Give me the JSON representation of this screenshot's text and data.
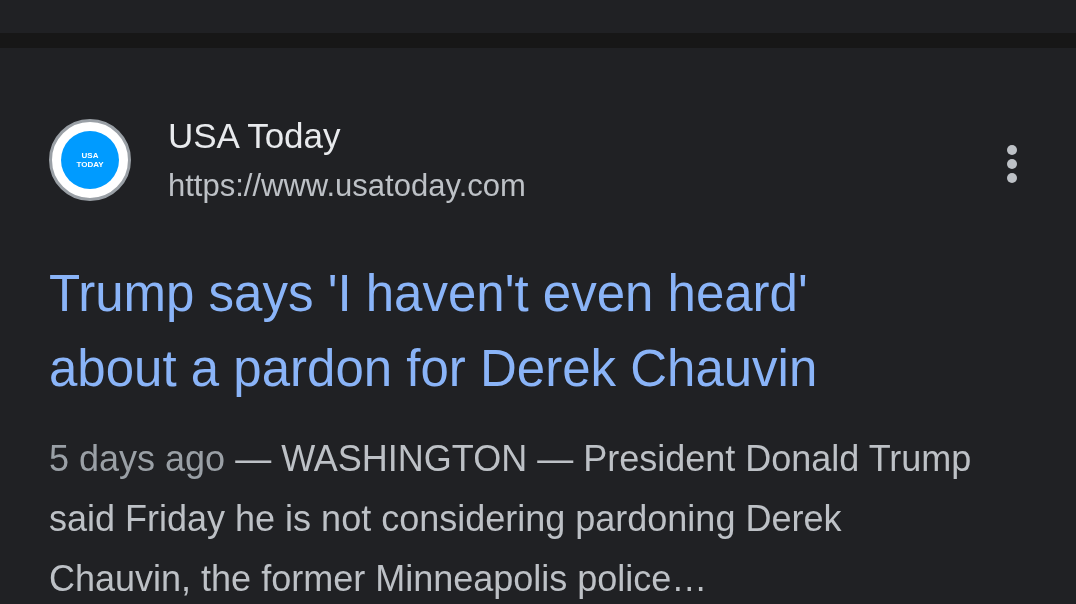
{
  "result": {
    "logo_text": [
      "USA",
      "TODAY"
    ],
    "source": "USA Today",
    "url": "https://www.usatoday.com",
    "title": "Trump says 'I haven't even heard' about a pardon for Derek Chauvin",
    "date": "5 days ago",
    "snippet": "— WASHINGTON — President Donald Trump said Friday he is not considering pardoning Derek Chauvin, the former Minneapolis police…"
  }
}
